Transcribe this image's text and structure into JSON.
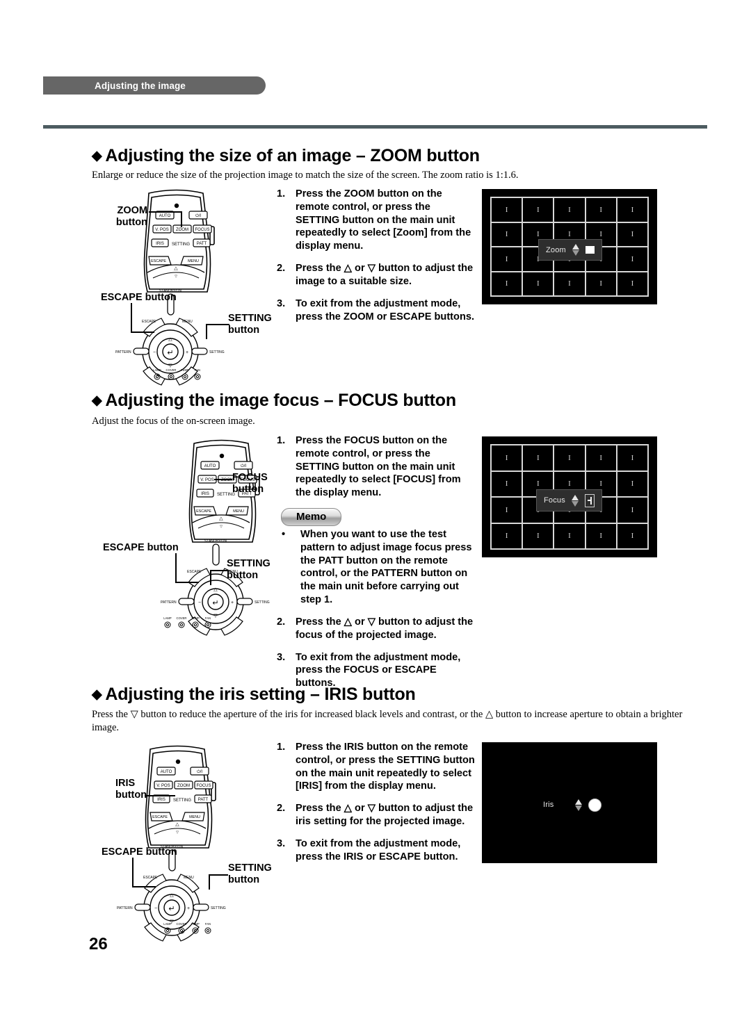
{
  "header": {
    "running_title": "Adjusting the image",
    "page_number": "26"
  },
  "sections": [
    {
      "id": "zoom",
      "diamond": "◆",
      "heading": "Adjusting the size of an image – ZOOM button",
      "intro": "Enlarge or reduce the size of the projection image to match the size of the screen. The zoom ratio is 1:1.6.",
      "steps": [
        {
          "num": "1.",
          "text": "Press the ZOOM button on the remote control, or press the SETTING button on the main unit repeatedly to select [Zoom] from the display menu."
        },
        {
          "num": "2.",
          "text": "Press the △ or ▽ button to adjust the image to a suitable size."
        },
        {
          "num": "3.",
          "text": "To exit from the adjustment mode, press the ZOOM or ESCAPE buttons."
        }
      ],
      "callouts": {
        "remote_button": "ZOOM\nbutton",
        "escape": "ESCAPE button",
        "setting": "SETTING\nbutton"
      },
      "screen": {
        "pattern": "grid",
        "cell_mark": "I",
        "osd_label": "Zoom",
        "osd_icon": "rectangle-icon",
        "osd_boxed": true
      }
    },
    {
      "id": "focus",
      "diamond": "◆",
      "heading": "Adjusting the image focus – FOCUS button",
      "intro": "Adjust the focus of the on-screen image.",
      "steps": [
        {
          "num": "1.",
          "text": "Press the FOCUS button on the remote control, or press the SETTING button on the main unit repeatedly to select [FOCUS] from the display menu."
        }
      ],
      "memo_label": "Memo",
      "memo_steps": [
        {
          "num": "•",
          "text": "When you want to use the test pattern to adjust image focus press the PATT button on the remote control, or the PATTERN button on the main unit before carrying out step 1."
        },
        {
          "num": "2.",
          "text": "Press the △ or ▽ button to adjust the  focus of the projected image."
        },
        {
          "num": "3.",
          "text": "To exit from the adjustment mode, press the FOCUS or ESCAPE buttons."
        }
      ],
      "callouts": {
        "remote_button": "FOCUS\nbutton",
        "escape": "ESCAPE button",
        "setting": "SETTING\nbutton"
      },
      "screen": {
        "pattern": "grid",
        "cell_mark": "I",
        "osd_label": "Focus",
        "osd_icon": "plus-icon",
        "osd_boxed": true
      }
    },
    {
      "id": "iris",
      "diamond": "◆",
      "heading": "Adjusting the iris setting – IRIS button",
      "intro": "Press the ▽ button to reduce the aperture of the iris for increased black levels and contrast, or the △ button to increase aperture to obtain a brighter image.",
      "steps": [
        {
          "num": "1.",
          "text": "Press the IRIS button on the remote control, or press the SETTING button on the main unit repeatedly to select [IRIS] from the display menu."
        },
        {
          "num": "2.",
          "text": " Press the △ or ▽ button to adjust the  iris setting for the projected image."
        },
        {
          "num": "3.",
          "text": "To exit from the adjustment mode, press the IRIS or ESCAPE button."
        }
      ],
      "callouts": {
        "remote_button": "IRIS\nbutton",
        "escape": "ESCAPE button",
        "setting": "SETTING\nbutton"
      },
      "screen": {
        "pattern": "blank",
        "cell_mark": "",
        "osd_label": "Iris",
        "osd_icon": "circle-icon",
        "osd_boxed": false
      }
    }
  ],
  "remote": {
    "top_buttons": [
      "AUTO",
      "⏻/I"
    ],
    "row2": [
      "V. POS",
      "ZOOM",
      "FOCUS"
    ],
    "row3_left": "IRIS",
    "row3_center": "SETTING",
    "row3_right": "PATT",
    "row4": [
      "ESCAPE",
      "MENU"
    ],
    "side_label": "ZOOM"
  },
  "control_panel": {
    "standby": "STANDBY/ON",
    "escape": "ESCAPE",
    "menu": "MENU",
    "pattern": "PATTERN",
    "setting": "SETTING",
    "aspect": "ASPECT",
    "input": "INPUT",
    "up": "△",
    "down": "▽",
    "left": "−",
    "right": "+",
    "enter": "↵",
    "indicators": [
      "LAMP",
      "COVER",
      "TEMP",
      "FAN"
    ]
  },
  "colors": {
    "header_bar": "#666666",
    "rule": "#4d5c61",
    "screen_bg": "#000000",
    "grid_line": "#d8d8d8",
    "osd_bg": "#2e2e2e"
  }
}
